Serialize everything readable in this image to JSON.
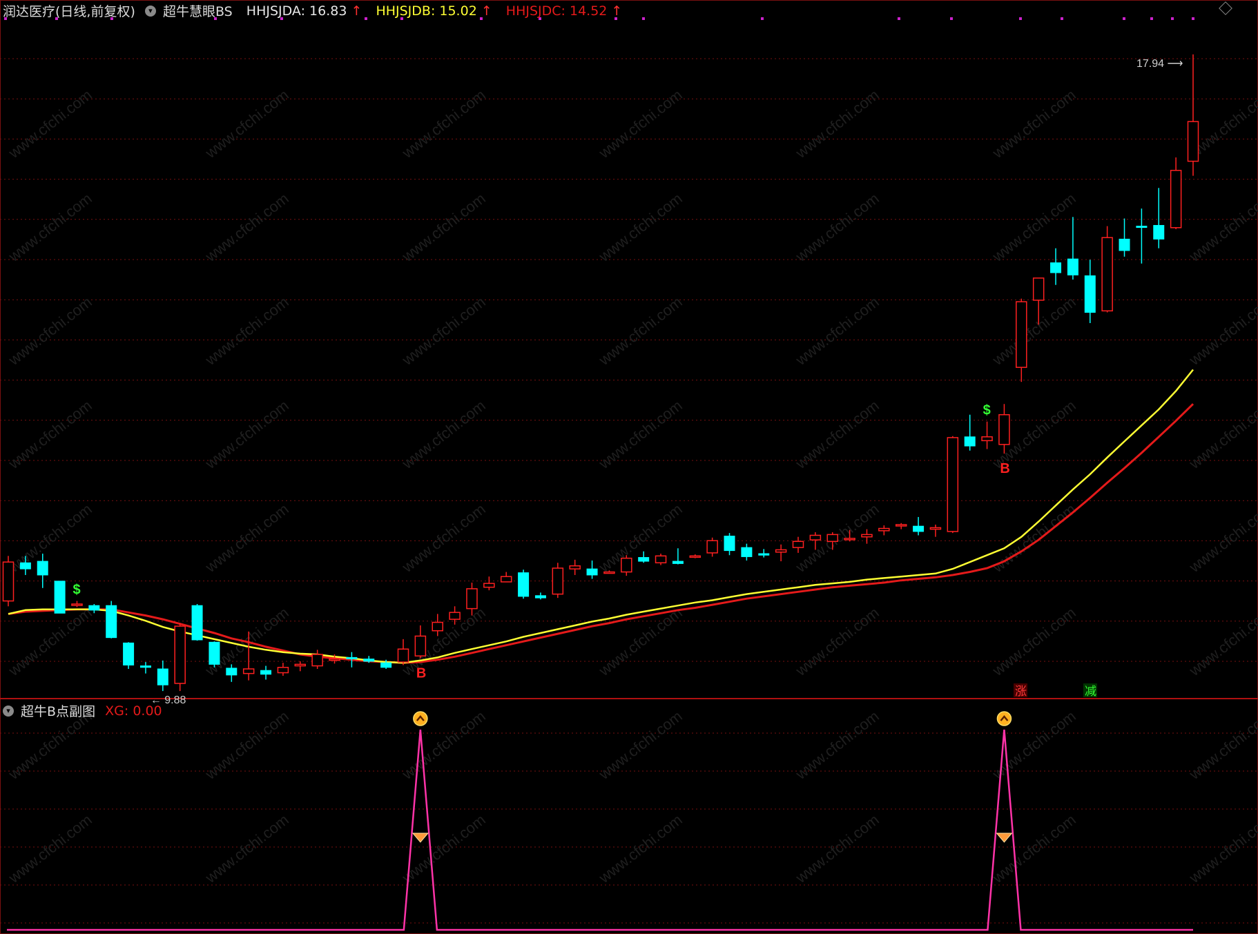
{
  "header": {
    "stock_title": "润达医疗(日线,前复权)",
    "indicator_name": "超牛慧眼BS",
    "a_label": "HHJSJDA: 16.83",
    "b_label": "HHJSJDB: 15.02",
    "c_label": "HHJSJDC: 14.52",
    "arrow": "↑"
  },
  "sub_header": {
    "title": "超牛B点副图",
    "xg_label": "XG: 0.00"
  },
  "annotations": {
    "high_label": "17.94",
    "low_label": "9.88",
    "buy_signal": "B",
    "sell_signal": "$",
    "zhang_tag": "涨",
    "jian_tag": "减"
  },
  "colors": {
    "background": "#000000",
    "up": "#ff2020",
    "down": "#00ffff",
    "line_a": "#ffff33",
    "line_c": "#e41a1a",
    "grid": "#7a1010",
    "sub_line": "#ff33a8",
    "signal_dots": "#cc22cc"
  },
  "chart_data": {
    "type": "candlestick",
    "price_range": [
      9.7,
      18.2
    ],
    "candles": [
      {
        "o": 10.78,
        "h": 11.37,
        "l": 10.71,
        "c": 11.29
      },
      {
        "o": 11.28,
        "h": 11.37,
        "l": 11.12,
        "c": 11.2
      },
      {
        "o": 11.3,
        "h": 11.4,
        "l": 10.95,
        "c": 11.12
      },
      {
        "o": 11.04,
        "h": 11.04,
        "l": 10.64,
        "c": 10.62
      },
      {
        "o": 10.74,
        "h": 10.78,
        "l": 10.7,
        "c": 10.74
      },
      {
        "o": 10.72,
        "h": 10.74,
        "l": 10.62,
        "c": 10.66
      },
      {
        "o": 10.72,
        "h": 10.78,
        "l": 10.29,
        "c": 10.3
      },
      {
        "o": 10.23,
        "h": 10.24,
        "l": 9.89,
        "c": 9.94
      },
      {
        "o": 9.93,
        "h": 9.98,
        "l": 9.83,
        "c": 9.91
      },
      {
        "o": 9.89,
        "h": 10.0,
        "l": 9.6,
        "c": 9.68
      },
      {
        "o": 9.7,
        "h": 10.49,
        "l": 9.6,
        "c": 10.45
      },
      {
        "o": 10.72,
        "h": 10.74,
        "l": 10.26,
        "c": 10.27
      },
      {
        "o": 10.24,
        "h": 10.25,
        "l": 9.91,
        "c": 9.95
      },
      {
        "o": 9.9,
        "h": 9.95,
        "l": 9.72,
        "c": 9.81
      },
      {
        "o": 9.83,
        "h": 10.38,
        "l": 9.74,
        "c": 9.89
      },
      {
        "o": 9.87,
        "h": 9.93,
        "l": 9.75,
        "c": 9.82
      },
      {
        "o": 9.84,
        "h": 9.97,
        "l": 9.8,
        "c": 9.91
      },
      {
        "o": 9.93,
        "h": 9.99,
        "l": 9.86,
        "c": 9.95
      },
      {
        "o": 9.93,
        "h": 10.14,
        "l": 9.89,
        "c": 10.08
      },
      {
        "o": 10.02,
        "h": 10.08,
        "l": 9.96,
        "c": 10.02
      },
      {
        "o": 10.04,
        "h": 10.11,
        "l": 9.91,
        "c": 10.03
      },
      {
        "o": 10.02,
        "h": 10.06,
        "l": 9.97,
        "c": 9.99
      },
      {
        "o": 9.97,
        "h": 10.01,
        "l": 9.89,
        "c": 9.91
      },
      {
        "o": 9.98,
        "h": 10.28,
        "l": 9.94,
        "c": 10.15
      },
      {
        "o": 10.06,
        "h": 10.46,
        "l": 10.03,
        "c": 10.32
      },
      {
        "o": 10.39,
        "h": 10.61,
        "l": 10.32,
        "c": 10.5
      },
      {
        "o": 10.54,
        "h": 10.71,
        "l": 10.47,
        "c": 10.63
      },
      {
        "o": 10.68,
        "h": 11.02,
        "l": 10.59,
        "c": 10.94
      },
      {
        "o": 10.96,
        "h": 11.1,
        "l": 10.92,
        "c": 11.01
      },
      {
        "o": 11.03,
        "h": 11.16,
        "l": 11.04,
        "c": 11.1
      },
      {
        "o": 11.15,
        "h": 11.19,
        "l": 10.81,
        "c": 10.84
      },
      {
        "o": 10.85,
        "h": 10.89,
        "l": 10.8,
        "c": 10.82
      },
      {
        "o": 10.87,
        "h": 11.28,
        "l": 10.82,
        "c": 11.21
      },
      {
        "o": 11.2,
        "h": 11.32,
        "l": 11.12,
        "c": 11.24
      },
      {
        "o": 11.2,
        "h": 11.31,
        "l": 11.07,
        "c": 11.12
      },
      {
        "o": 11.16,
        "h": 11.18,
        "l": 11.14,
        "c": 11.16
      },
      {
        "o": 11.16,
        "h": 11.38,
        "l": 11.11,
        "c": 11.34
      },
      {
        "o": 11.35,
        "h": 11.43,
        "l": 11.28,
        "c": 11.3
      },
      {
        "o": 11.28,
        "h": 11.4,
        "l": 11.25,
        "c": 11.37
      },
      {
        "o": 11.3,
        "h": 11.47,
        "l": 11.26,
        "c": 11.27
      },
      {
        "o": 11.36,
        "h": 11.39,
        "l": 11.34,
        "c": 11.37
      },
      {
        "o": 11.41,
        "h": 11.61,
        "l": 11.36,
        "c": 11.57
      },
      {
        "o": 11.63,
        "h": 11.67,
        "l": 11.38,
        "c": 11.44
      },
      {
        "o": 11.48,
        "h": 11.53,
        "l": 11.31,
        "c": 11.36
      },
      {
        "o": 11.4,
        "h": 11.46,
        "l": 11.35,
        "c": 11.38
      },
      {
        "o": 11.42,
        "h": 11.52,
        "l": 11.3,
        "c": 11.45
      },
      {
        "o": 11.48,
        "h": 11.62,
        "l": 11.41,
        "c": 11.56
      },
      {
        "o": 11.58,
        "h": 11.68,
        "l": 11.45,
        "c": 11.64
      },
      {
        "o": 11.56,
        "h": 11.68,
        "l": 11.45,
        "c": 11.65
      },
      {
        "o": 11.59,
        "h": 11.71,
        "l": 11.56,
        "c": 11.6
      },
      {
        "o": 11.62,
        "h": 11.72,
        "l": 11.53,
        "c": 11.65
      },
      {
        "o": 11.7,
        "h": 11.77,
        "l": 11.64,
        "c": 11.73
      },
      {
        "o": 11.77,
        "h": 11.8,
        "l": 11.72,
        "c": 11.78
      },
      {
        "o": 11.76,
        "h": 11.88,
        "l": 11.64,
        "c": 11.69
      },
      {
        "o": 11.72,
        "h": 11.78,
        "l": 11.62,
        "c": 11.74
      },
      {
        "o": 11.69,
        "h": 12.94,
        "l": 11.67,
        "c": 12.92
      },
      {
        "o": 12.93,
        "h": 13.22,
        "l": 12.75,
        "c": 12.81
      },
      {
        "o": 12.88,
        "h": 13.13,
        "l": 12.77,
        "c": 12.93
      },
      {
        "o": 12.83,
        "h": 13.36,
        "l": 12.71,
        "c": 13.22
      },
      {
        "o": 13.84,
        "h": 14.74,
        "l": 13.65,
        "c": 14.7
      },
      {
        "o": 14.72,
        "h": 14.94,
        "l": 14.4,
        "c": 15.01
      },
      {
        "o": 15.21,
        "h": 15.4,
        "l": 14.92,
        "c": 15.08
      },
      {
        "o": 15.26,
        "h": 15.81,
        "l": 14.99,
        "c": 15.05
      },
      {
        "o": 15.04,
        "h": 15.25,
        "l": 14.42,
        "c": 14.56
      },
      {
        "o": 14.58,
        "h": 15.69,
        "l": 14.56,
        "c": 15.54
      },
      {
        "o": 15.52,
        "h": 15.79,
        "l": 15.29,
        "c": 15.37
      },
      {
        "o": 15.69,
        "h": 15.92,
        "l": 15.2,
        "c": 15.68
      },
      {
        "o": 15.7,
        "h": 16.19,
        "l": 15.4,
        "c": 15.52
      },
      {
        "o": 15.67,
        "h": 16.59,
        "l": 15.65,
        "c": 16.42
      },
      {
        "o": 16.54,
        "h": 17.94,
        "l": 16.35,
        "c": 17.06
      }
    ],
    "line_a": [
      10.61,
      10.66,
      10.67,
      10.67,
      10.67,
      10.67,
      10.65,
      10.59,
      10.52,
      10.44,
      10.38,
      10.33,
      10.28,
      10.23,
      10.18,
      10.14,
      10.11,
      10.09,
      10.08,
      10.05,
      10.03,
      10.0,
      9.98,
      9.97,
      10.0,
      10.04,
      10.1,
      10.15,
      10.2,
      10.25,
      10.31,
      10.36,
      10.41,
      10.46,
      10.51,
      10.55,
      10.6,
      10.64,
      10.68,
      10.72,
      10.76,
      10.79,
      10.83,
      10.87,
      10.9,
      10.93,
      10.96,
      10.99,
      11.01,
      11.03,
      11.06,
      11.08,
      11.1,
      11.12,
      11.14,
      11.2,
      11.29,
      11.38,
      11.47,
      11.62,
      11.82,
      12.03,
      12.24,
      12.44,
      12.66,
      12.87,
      13.08,
      13.29,
      13.53,
      13.81
    ],
    "line_c": [
      10.61,
      10.64,
      10.65,
      10.66,
      10.67,
      10.67,
      10.67,
      10.63,
      10.59,
      10.54,
      10.48,
      10.42,
      10.36,
      10.29,
      10.24,
      10.18,
      10.13,
      10.08,
      10.05,
      10.03,
      10.01,
      9.99,
      9.98,
      9.97,
      9.98,
      10.01,
      10.05,
      10.1,
      10.15,
      10.2,
      10.25,
      10.3,
      10.35,
      10.4,
      10.45,
      10.49,
      10.54,
      10.58,
      10.62,
      10.66,
      10.69,
      10.73,
      10.77,
      10.81,
      10.84,
      10.87,
      10.9,
      10.93,
      10.96,
      10.98,
      11.0,
      11.02,
      11.05,
      11.07,
      11.09,
      11.12,
      11.16,
      11.21,
      11.3,
      11.43,
      11.58,
      11.76,
      11.94,
      12.13,
      12.33,
      12.52,
      12.72,
      12.93,
      13.14,
      13.36
    ],
    "buy_signals": [
      24,
      58
    ],
    "sell_signals": [
      4,
      57
    ],
    "sub_chart": {
      "series": "XG",
      "spike_indices": [
        24,
        58
      ],
      "spike_value": 1,
      "range": [
        0,
        1.1
      ]
    }
  }
}
